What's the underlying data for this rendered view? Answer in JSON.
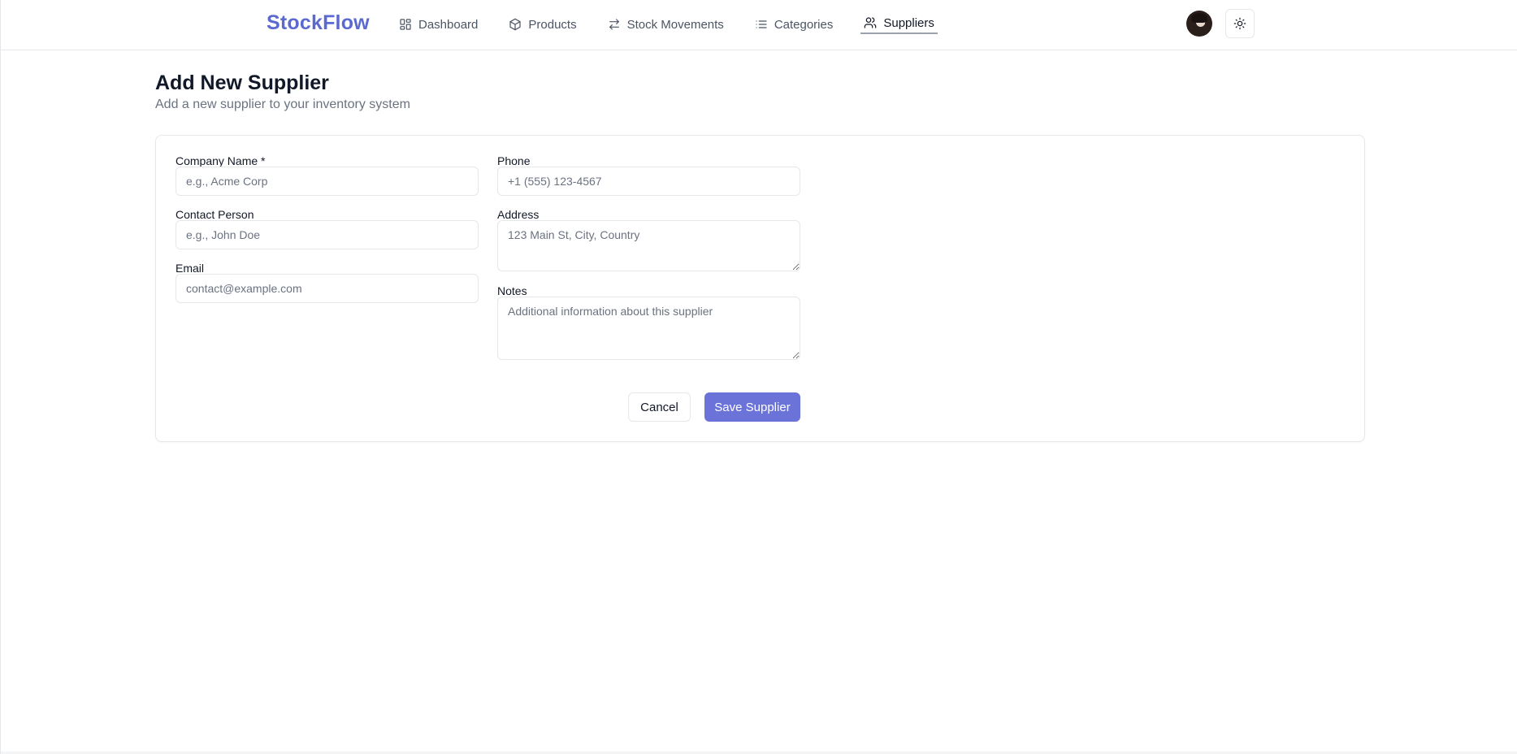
{
  "app": {
    "brand": "StockFlow"
  },
  "nav": {
    "items": [
      {
        "label": "Dashboard",
        "icon": "dashboard-icon"
      },
      {
        "label": "Products",
        "icon": "box-icon"
      },
      {
        "label": "Stock Movements",
        "icon": "arrows-left-right-icon"
      },
      {
        "label": "Categories",
        "icon": "list-icon"
      },
      {
        "label": "Suppliers",
        "icon": "users-icon",
        "active": true
      }
    ]
  },
  "header_actions": {
    "avatar": "user-avatar",
    "theme_toggle_icon": "sun-icon"
  },
  "page": {
    "title": "Add New Supplier",
    "subtitle": "Add a new supplier to your inventory system"
  },
  "form": {
    "company_name": {
      "label": "Company Name *",
      "placeholder": "e.g., Acme Corp",
      "value": ""
    },
    "contact_person": {
      "label": "Contact Person",
      "placeholder": "e.g., John Doe",
      "value": ""
    },
    "email": {
      "label": "Email",
      "placeholder": "contact@example.com",
      "value": ""
    },
    "phone": {
      "label": "Phone",
      "placeholder": "+1 (555) 123-4567",
      "value": ""
    },
    "address": {
      "label": "Address",
      "placeholder": "123 Main St, City, Country",
      "value": ""
    },
    "notes": {
      "label": "Notes",
      "placeholder": "Additional information about this supplier",
      "value": ""
    },
    "cancel_label": "Cancel",
    "save_label": "Save Supplier"
  },
  "colors": {
    "brand": "#5b6ad0",
    "primary_button": "#6b73d9",
    "border": "#e5e7eb",
    "muted_text": "#6b7280"
  }
}
